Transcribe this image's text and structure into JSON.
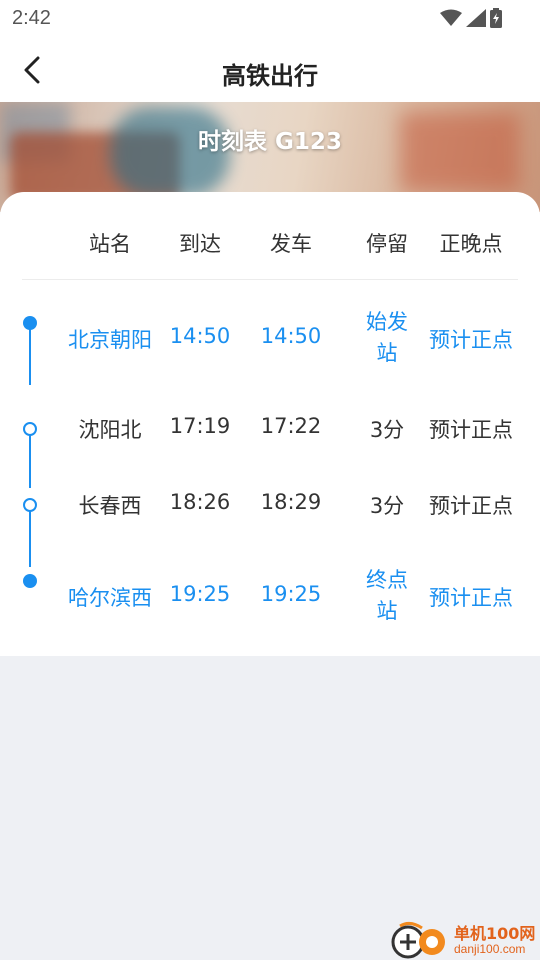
{
  "status_bar": {
    "time": "2:42"
  },
  "header": {
    "title": "高铁出行"
  },
  "banner": {
    "title": "时刻表 G123"
  },
  "table": {
    "columns": [
      "站名",
      "到达",
      "发车",
      "停留",
      "正晚点"
    ],
    "rows": [
      {
        "station": "北京朝阳",
        "arrive": "14:50",
        "depart": "14:50",
        "stay_line1": "始发",
        "stay_line2": "站",
        "punctuality": "预计正点",
        "highlight": true
      },
      {
        "station": "沈阳北",
        "arrive": "17:19",
        "depart": "17:22",
        "stay": "3分",
        "punctuality": "预计正点",
        "highlight": false
      },
      {
        "station": "长春西",
        "arrive": "18:26",
        "depart": "18:29",
        "stay": "3分",
        "punctuality": "预计正点",
        "highlight": false
      },
      {
        "station": "哈尔滨西",
        "arrive": "19:25",
        "depart": "19:25",
        "stay_line1": "终点",
        "stay_line2": "站",
        "punctuality": "预计正点",
        "highlight": true
      }
    ]
  },
  "watermark": {
    "name": "单机100网",
    "url": "danji100.com"
  },
  "colors": {
    "accent": "#1a8ff0",
    "text": "#333333",
    "background": "#eef0f4"
  },
  "icons": {
    "back": "chevron-left-icon",
    "wifi": "wifi-icon",
    "signal": "signal-icon",
    "battery": "battery-icon"
  }
}
